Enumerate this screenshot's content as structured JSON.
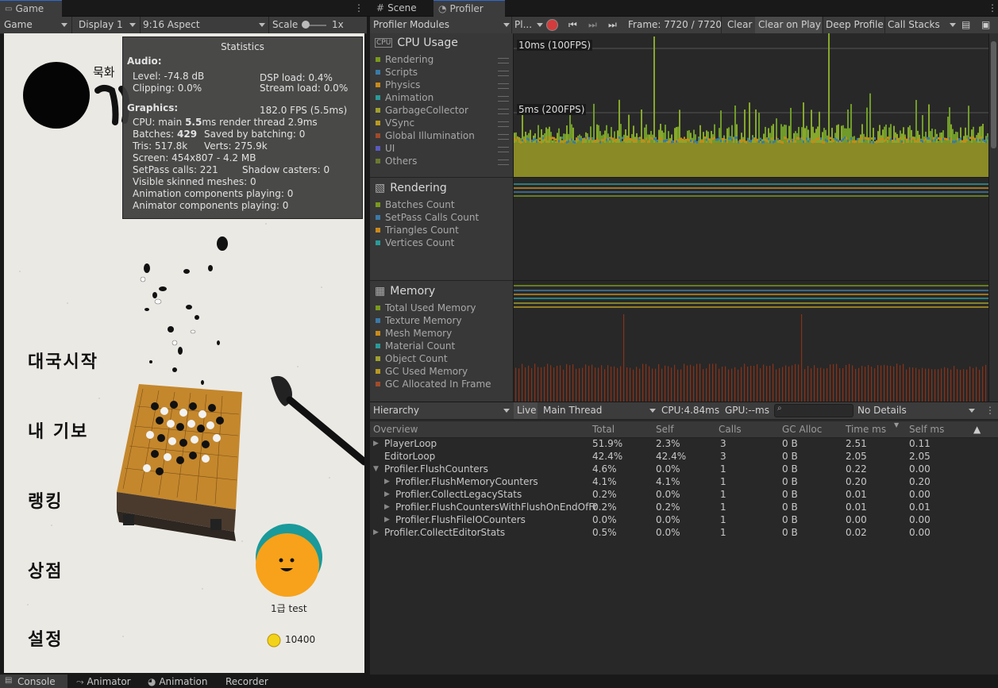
{
  "tabs_left": {
    "game": "Game"
  },
  "tabs_right": {
    "scene": "Scene",
    "profiler": "Profiler"
  },
  "game_toolbar": {
    "mode": "Game",
    "display": "Display 1",
    "aspect": "9:16 Aspect",
    "scale_label": "Scale",
    "scale_value": "1x"
  },
  "stats": {
    "title": "Statistics",
    "audio_label": "Audio:",
    "level": "Level: -74.8 dB",
    "dsp": "DSP load: 0.4%",
    "clipping": "Clipping: 0.0%",
    "stream": "Stream load: 0.0%",
    "graphics_label": "Graphics:",
    "fps": "182.0 FPS (5.5ms)",
    "cpu_prefix": "CPU: main ",
    "cpu_main": "5.5",
    "cpu_suffix": "ms  render thread 2.9ms",
    "batches_prefix": "Batches: ",
    "batches": "429",
    "saved": "Saved by batching: 0",
    "tris": "Tris: 517.8k",
    "verts": "Verts: 275.9k",
    "screen": "Screen: 454x807 - 4.2 MB",
    "setpass": "SetPass calls: 221",
    "shadow": "Shadow casters: 0",
    "skinned": "Visible skinned meshes: 0",
    "anim": "Animation components playing: 0",
    "animator": "Animator components playing: 0"
  },
  "game": {
    "title_partial": "묵화",
    "menu": [
      "대국시작",
      "내 기보",
      "랭킹",
      "상점",
      "설정"
    ],
    "player_name": "1급 test",
    "coins": "10400"
  },
  "profiler_toolbar": {
    "modules": "Profiler Modules",
    "target": "Pl...",
    "frame": "Frame: 7720 / 7720",
    "clear": "Clear",
    "clear_on_play": "Clear on Play",
    "deep_profile": "Deep Profile",
    "call_stacks": "Call Stacks"
  },
  "modules": {
    "cpu": {
      "title": "CPU Usage",
      "items": [
        {
          "label": "Rendering",
          "color": "#7a9a1c"
        },
        {
          "label": "Scripts",
          "color": "#3a7aa8"
        },
        {
          "label": "Physics",
          "color": "#c98a1a"
        },
        {
          "label": "Animation",
          "color": "#2a9a9a"
        },
        {
          "label": "GarbageCollector",
          "color": "#a0a030"
        },
        {
          "label": "VSync",
          "color": "#b89a20"
        },
        {
          "label": "Global Illumination",
          "color": "#a04a2a"
        },
        {
          "label": "UI",
          "color": "#5a5ac0"
        },
        {
          "label": "Others",
          "color": "#6a7a30"
        }
      ]
    },
    "rendering": {
      "title": "Rendering",
      "items": [
        {
          "label": "Batches Count",
          "color": "#7a9a1c"
        },
        {
          "label": "SetPass Calls Count",
          "color": "#3a7aa8"
        },
        {
          "label": "Triangles Count",
          "color": "#c98a1a"
        },
        {
          "label": "Vertices Count",
          "color": "#2a9a9a"
        }
      ]
    },
    "memory": {
      "title": "Memory",
      "items": [
        {
          "label": "Total Used Memory",
          "color": "#7a9a1c"
        },
        {
          "label": "Texture Memory",
          "color": "#3a7aa8"
        },
        {
          "label": "Mesh Memory",
          "color": "#c98a1a"
        },
        {
          "label": "Material Count",
          "color": "#2a9a9a"
        },
        {
          "label": "Object Count",
          "color": "#a0a030"
        },
        {
          "label": "GC Used Memory",
          "color": "#b89a20"
        },
        {
          "label": "GC Allocated In Frame",
          "color": "#a04a2a"
        }
      ]
    }
  },
  "chart_labels": {
    "ms10": "10ms (100FPS)",
    "ms5": "5ms (200FPS)"
  },
  "hierarchy_bar": {
    "view": "Hierarchy",
    "live": "Live",
    "thread": "Main Thread",
    "cpu": "CPU:4.84ms",
    "gpu": "GPU:--ms",
    "details": "No Details"
  },
  "columns": [
    "Overview",
    "Total",
    "Self",
    "Calls",
    "GC Alloc",
    "Time ms",
    "Self ms"
  ],
  "rows": [
    {
      "name": "PlayerLoop",
      "indent": 0,
      "arrow": "▶",
      "total": "51.9%",
      "self": "2.3%",
      "calls": "3",
      "gc": "0 B",
      "time": "2.51",
      "selfms": "0.11"
    },
    {
      "name": "EditorLoop",
      "indent": 0,
      "arrow": "",
      "total": "42.4%",
      "self": "42.4%",
      "calls": "3",
      "gc": "0 B",
      "time": "2.05",
      "selfms": "2.05"
    },
    {
      "name": "Profiler.FlushCounters",
      "indent": 0,
      "arrow": "▼",
      "total": "4.6%",
      "self": "0.0%",
      "calls": "1",
      "gc": "0 B",
      "time": "0.22",
      "selfms": "0.00"
    },
    {
      "name": "Profiler.FlushMemoryCounters",
      "indent": 1,
      "arrow": "▶",
      "total": "4.1%",
      "self": "4.1%",
      "calls": "1",
      "gc": "0 B",
      "time": "0.20",
      "selfms": "0.20"
    },
    {
      "name": "Profiler.CollectLegacyStats",
      "indent": 1,
      "arrow": "▶",
      "total": "0.2%",
      "self": "0.0%",
      "calls": "1",
      "gc": "0 B",
      "time": "0.01",
      "selfms": "0.00"
    },
    {
      "name": "Profiler.FlushCountersWithFlushOnEndOfFr",
      "indent": 1,
      "arrow": "▶",
      "total": "0.2%",
      "self": "0.2%",
      "calls": "1",
      "gc": "0 B",
      "time": "0.01",
      "selfms": "0.01"
    },
    {
      "name": "Profiler.FlushFileIOCounters",
      "indent": 1,
      "arrow": "▶",
      "total": "0.0%",
      "self": "0.0%",
      "calls": "1",
      "gc": "0 B",
      "time": "0.00",
      "selfms": "0.00"
    },
    {
      "name": "Profiler.CollectEditorStats",
      "indent": 0,
      "arrow": "▶",
      "total": "0.5%",
      "self": "0.0%",
      "calls": "1",
      "gc": "0 B",
      "time": "0.02",
      "selfms": "0.00"
    }
  ],
  "bottom_tabs": [
    "Console",
    "Animator",
    "Animation",
    "Recorder"
  ]
}
